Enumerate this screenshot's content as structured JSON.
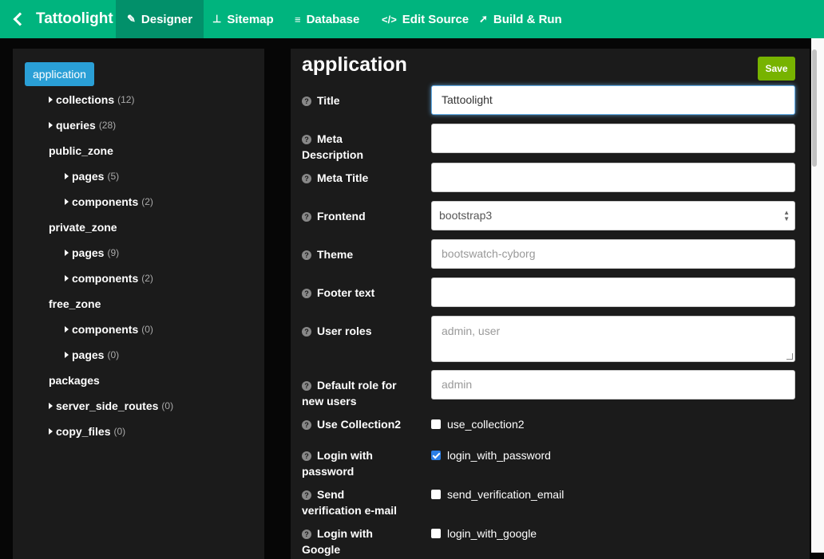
{
  "navbar": {
    "brand": "Tattoolight",
    "items": [
      {
        "label": "Designer",
        "icon": "edit-icon",
        "glyph": "✎"
      },
      {
        "label": "Sitemap",
        "icon": "sitemap-icon",
        "glyph": "⊥"
      },
      {
        "label": "Database",
        "icon": "database-icon",
        "glyph": "≡"
      },
      {
        "label": "Edit Source",
        "icon": "code-icon",
        "glyph": "</>"
      },
      {
        "label": "Build & Run",
        "icon": "rocket-icon",
        "glyph": "➚"
      }
    ],
    "active_index": 0,
    "colors": {
      "bar": "#00b47e",
      "active": "#02906a"
    }
  },
  "tree": {
    "root": "application",
    "nodes": [
      {
        "label": "collections",
        "count": "(12)",
        "caret": true
      },
      {
        "label": "queries",
        "count": "(28)",
        "caret": true
      },
      {
        "label": "public_zone",
        "count": "",
        "caret": false
      },
      {
        "label": "pages",
        "count": "(5)",
        "caret": true
      },
      {
        "label": "components",
        "count": "(2)",
        "caret": true
      },
      {
        "label": "private_zone",
        "count": "",
        "caret": false
      },
      {
        "label": "pages",
        "count": "(9)",
        "caret": true
      },
      {
        "label": "components",
        "count": "(2)",
        "caret": true
      },
      {
        "label": "free_zone",
        "count": "",
        "caret": false
      },
      {
        "label": "components",
        "count": "(0)",
        "caret": true
      },
      {
        "label": "pages",
        "count": "(0)",
        "caret": true
      },
      {
        "label": "packages",
        "count": "",
        "caret": false
      },
      {
        "label": "server_side_routes",
        "count": "(0)",
        "caret": true
      },
      {
        "label": "copy_files",
        "count": "(0)",
        "caret": true
      }
    ]
  },
  "form": {
    "title": "application",
    "save_label": "Save",
    "fields": {
      "title": {
        "label": "Title",
        "value": "Tattoolight"
      },
      "meta_description": {
        "label_1": "Meta",
        "label_2": "Description",
        "value": ""
      },
      "meta_title": {
        "label": "Meta Title",
        "value": ""
      },
      "frontend": {
        "label": "Frontend",
        "value": "bootstrap3"
      },
      "theme": {
        "label": "Theme",
        "value": "bootswatch-cyborg"
      },
      "footer_text": {
        "label": "Footer text",
        "value": ""
      },
      "user_roles": {
        "label": "User roles",
        "value": "admin, user"
      },
      "default_role": {
        "label_1": "Default role for",
        "label_2": "new users",
        "value": "admin"
      },
      "use_collection2": {
        "label": "Use Collection2",
        "option": "use_collection2",
        "checked": false
      },
      "login_with_password": {
        "label_1": "Login with",
        "label_2": "password",
        "option": "login_with_password",
        "checked": true
      },
      "send_verification": {
        "label_1": "Send",
        "label_2": "verification e-mail",
        "option": "send_verification_email",
        "checked": false
      },
      "login_with_google": {
        "label_1": "Login with",
        "label_2": "Google",
        "option": "login_with_google",
        "checked": false
      }
    }
  },
  "colors": {
    "accent_blue": "#2a9fd6",
    "save_green": "#77b300",
    "panel_bg": "#1b1b1b"
  }
}
